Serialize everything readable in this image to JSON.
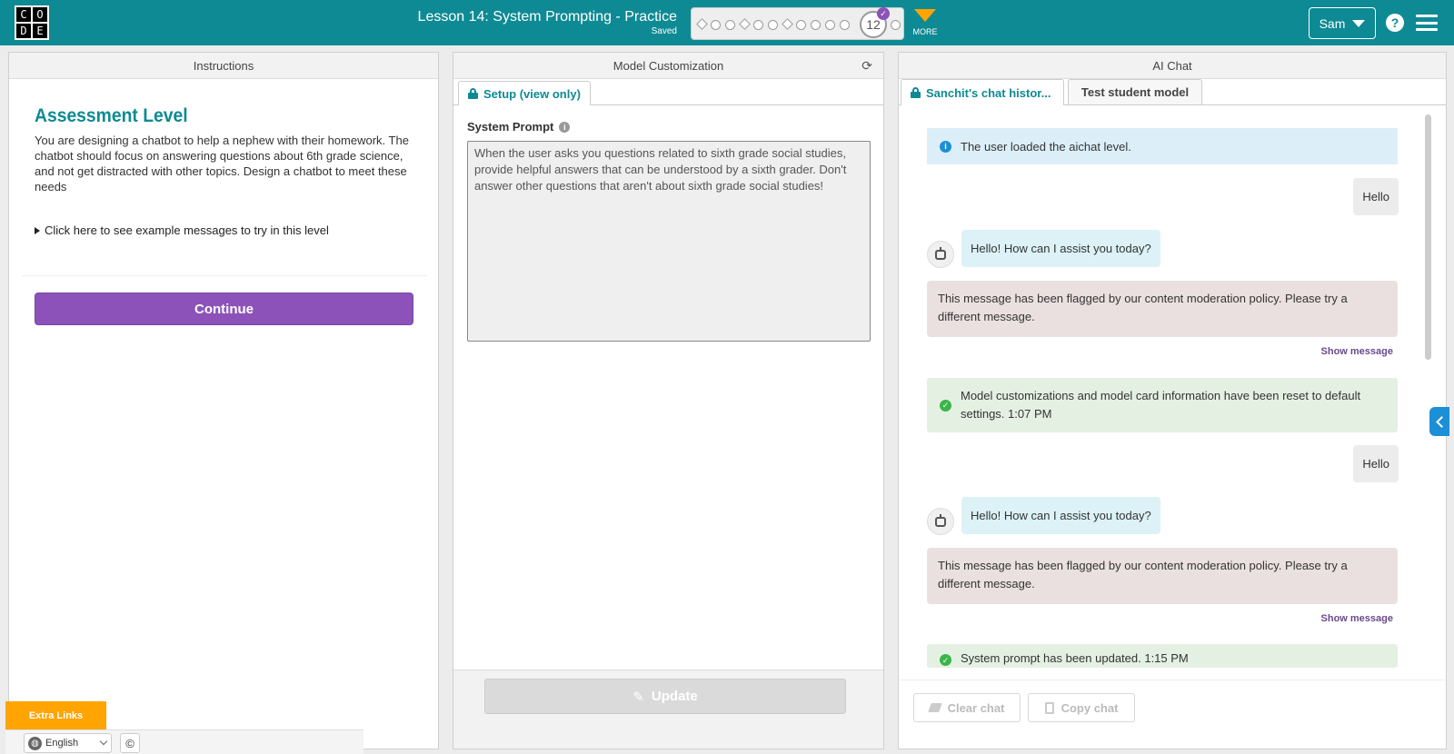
{
  "header": {
    "logo_letters": [
      "C",
      "O",
      "D",
      "E"
    ],
    "lesson_title": "Lesson 14: System Prompting - Practice",
    "saved_label": "Saved",
    "progress_current": "12",
    "more_label": "MORE",
    "user_name": "Sam",
    "help_label": "?"
  },
  "instructions": {
    "panel_title": "Instructions",
    "heading": "Assessment Level",
    "body": "You are designing a chatbot to help a nephew with their homework. The chatbot should focus on answering questions about 6th grade science, and not get distracted with other topics. Design a chatbot to meet these needs",
    "examples_toggle": "Click here to see example messages to try in this level",
    "continue_label": "Continue"
  },
  "footer": {
    "extra_links": "Extra Links",
    "language": "English",
    "copyright_symbol": "©"
  },
  "model": {
    "panel_title": "Model Customization",
    "tab_label": "Setup (view only)",
    "system_prompt_label": "System Prompt",
    "system_prompt_value": "When the user asks you questions related to sixth grade social studies, provide helpful answers that can be understood by a sixth grader. Don't answer other questions that aren't about sixth grade social studies!",
    "update_label": "Update"
  },
  "chat": {
    "panel_title": "AI Chat",
    "tab_history": "Sanchit's chat histor...",
    "tab_test": "Test student model",
    "messages": {
      "loaded": "The user loaded the aichat level.",
      "user1": "Hello",
      "bot1": "Hello! How can I assist you today?",
      "flag1": "This message has been flagged by our content moderation policy. Please try a different message.",
      "show1": "Show message",
      "reset": "Model customizations and model card information have been reset to default settings. 1:07 PM",
      "user2": "Hello",
      "bot2": "Hello! How can I assist you today?",
      "flag2": "This message has been flagged by our content moderation policy. Please try a different message.",
      "show2": "Show message",
      "updated": "System prompt has been updated. 1:15 PM"
    },
    "clear_label": "Clear chat",
    "copy_label": "Copy chat"
  },
  "colors": {
    "header": "#0e8a94",
    "continue": "#8c52ba",
    "more_arrow": "#ffa400",
    "extra_links": "#ffa400"
  }
}
